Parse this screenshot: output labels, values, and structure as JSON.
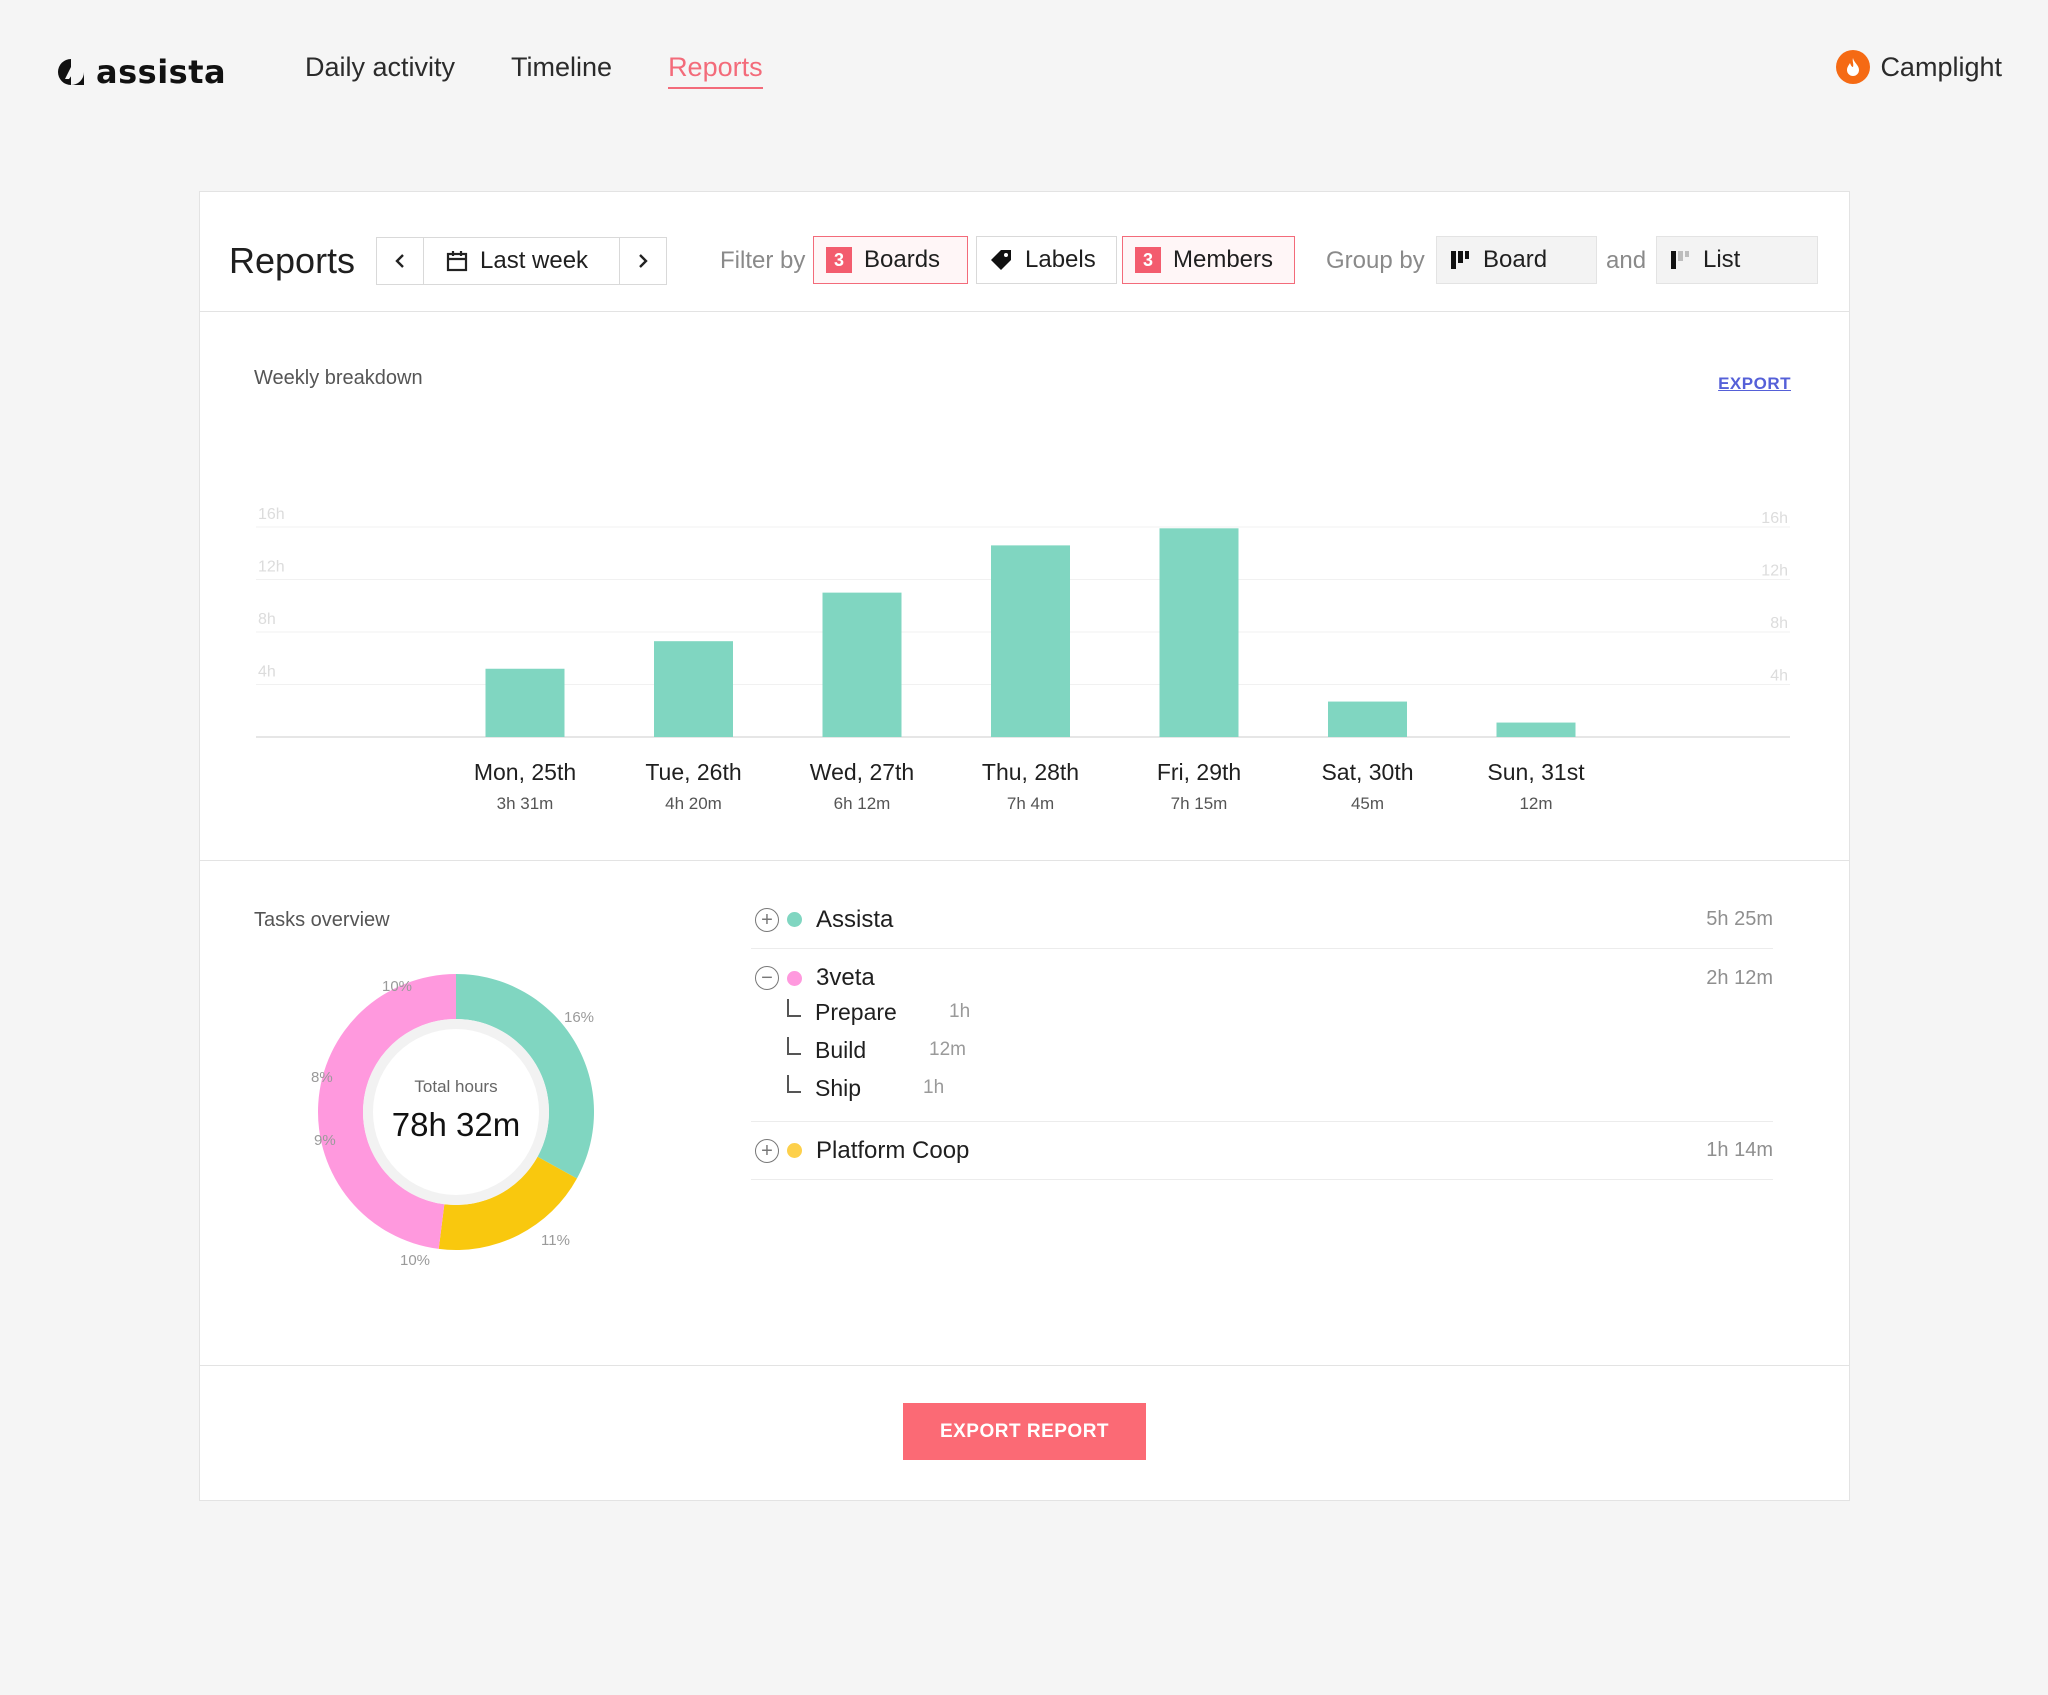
{
  "brand": {
    "logo_text": "assista"
  },
  "nav": {
    "items": [
      {
        "label": "Daily activity",
        "active": false
      },
      {
        "label": "Timeline",
        "active": false
      },
      {
        "label": "Reports",
        "active": true
      }
    ]
  },
  "org": {
    "name": "Camplight",
    "icon": "flame-icon",
    "color": "#f56a14"
  },
  "toolbar": {
    "title": "Reports",
    "date_range": "Last week",
    "filter_label": "Filter by",
    "filters": [
      {
        "label": "Boards",
        "count": "3",
        "highlight": true
      },
      {
        "label": "Labels",
        "count": null,
        "highlight": false,
        "icon": "tag-icon"
      },
      {
        "label": "Members",
        "count": "3",
        "highlight": true
      }
    ],
    "group_label": "Group by",
    "group_primary": "Board",
    "group_and": "and",
    "group_secondary": "List"
  },
  "weekly": {
    "title": "Weekly breakdown",
    "export_label": "EXPORT"
  },
  "chart_data": [
    {
      "type": "bar",
      "categories": [
        "Mon, 25th",
        "Tue, 26th",
        "Wed, 27th",
        "Thu, 28th",
        "Fri, 29th",
        "Sat, 30th",
        "Sun, 31st"
      ],
      "value_labels": [
        "3h 31m",
        "4h 20m",
        "6h 12m",
        "7h 4m",
        "7h 15m",
        "45m",
        "12m"
      ],
      "values": [
        5.2,
        7.3,
        11,
        14.6,
        15.9,
        2.7,
        1.1
      ],
      "yticks": [
        "16h",
        "12h",
        "8h",
        "4h"
      ],
      "ytick_values": [
        16,
        12,
        8,
        4
      ],
      "ylim": [
        0,
        16
      ],
      "color": "#80d6c1",
      "grid": true
    },
    {
      "type": "pie",
      "title": "Total hours",
      "total": "78h 32m",
      "slices": [
        {
          "value": 33,
          "color": "#80d6c1"
        },
        {
          "value": 19,
          "color": "#f9c80e"
        },
        {
          "value": 48,
          "color": "#ff99de"
        }
      ],
      "labels": [
        "16%",
        "11%",
        "10%",
        "9%",
        "8%",
        "10%"
      ]
    }
  ],
  "tasks": {
    "title": "Tasks overview",
    "items": [
      {
        "name": "Assista",
        "time": "5h 25m",
        "color": "#80d6c1",
        "expanded": false,
        "children": []
      },
      {
        "name": "3veta",
        "time": "2h 12m",
        "color": "#ff99de",
        "expanded": true,
        "children": [
          {
            "name": "Prepare",
            "time": "1h"
          },
          {
            "name": "Build",
            "time": "12m"
          },
          {
            "name": "Ship",
            "time": "1h"
          }
        ]
      },
      {
        "name": "Platform Coop",
        "time": "1h 14m",
        "color": "#fdd04b",
        "expanded": false,
        "children": []
      }
    ]
  },
  "footer": {
    "export_label": "EXPORT REPORT"
  }
}
